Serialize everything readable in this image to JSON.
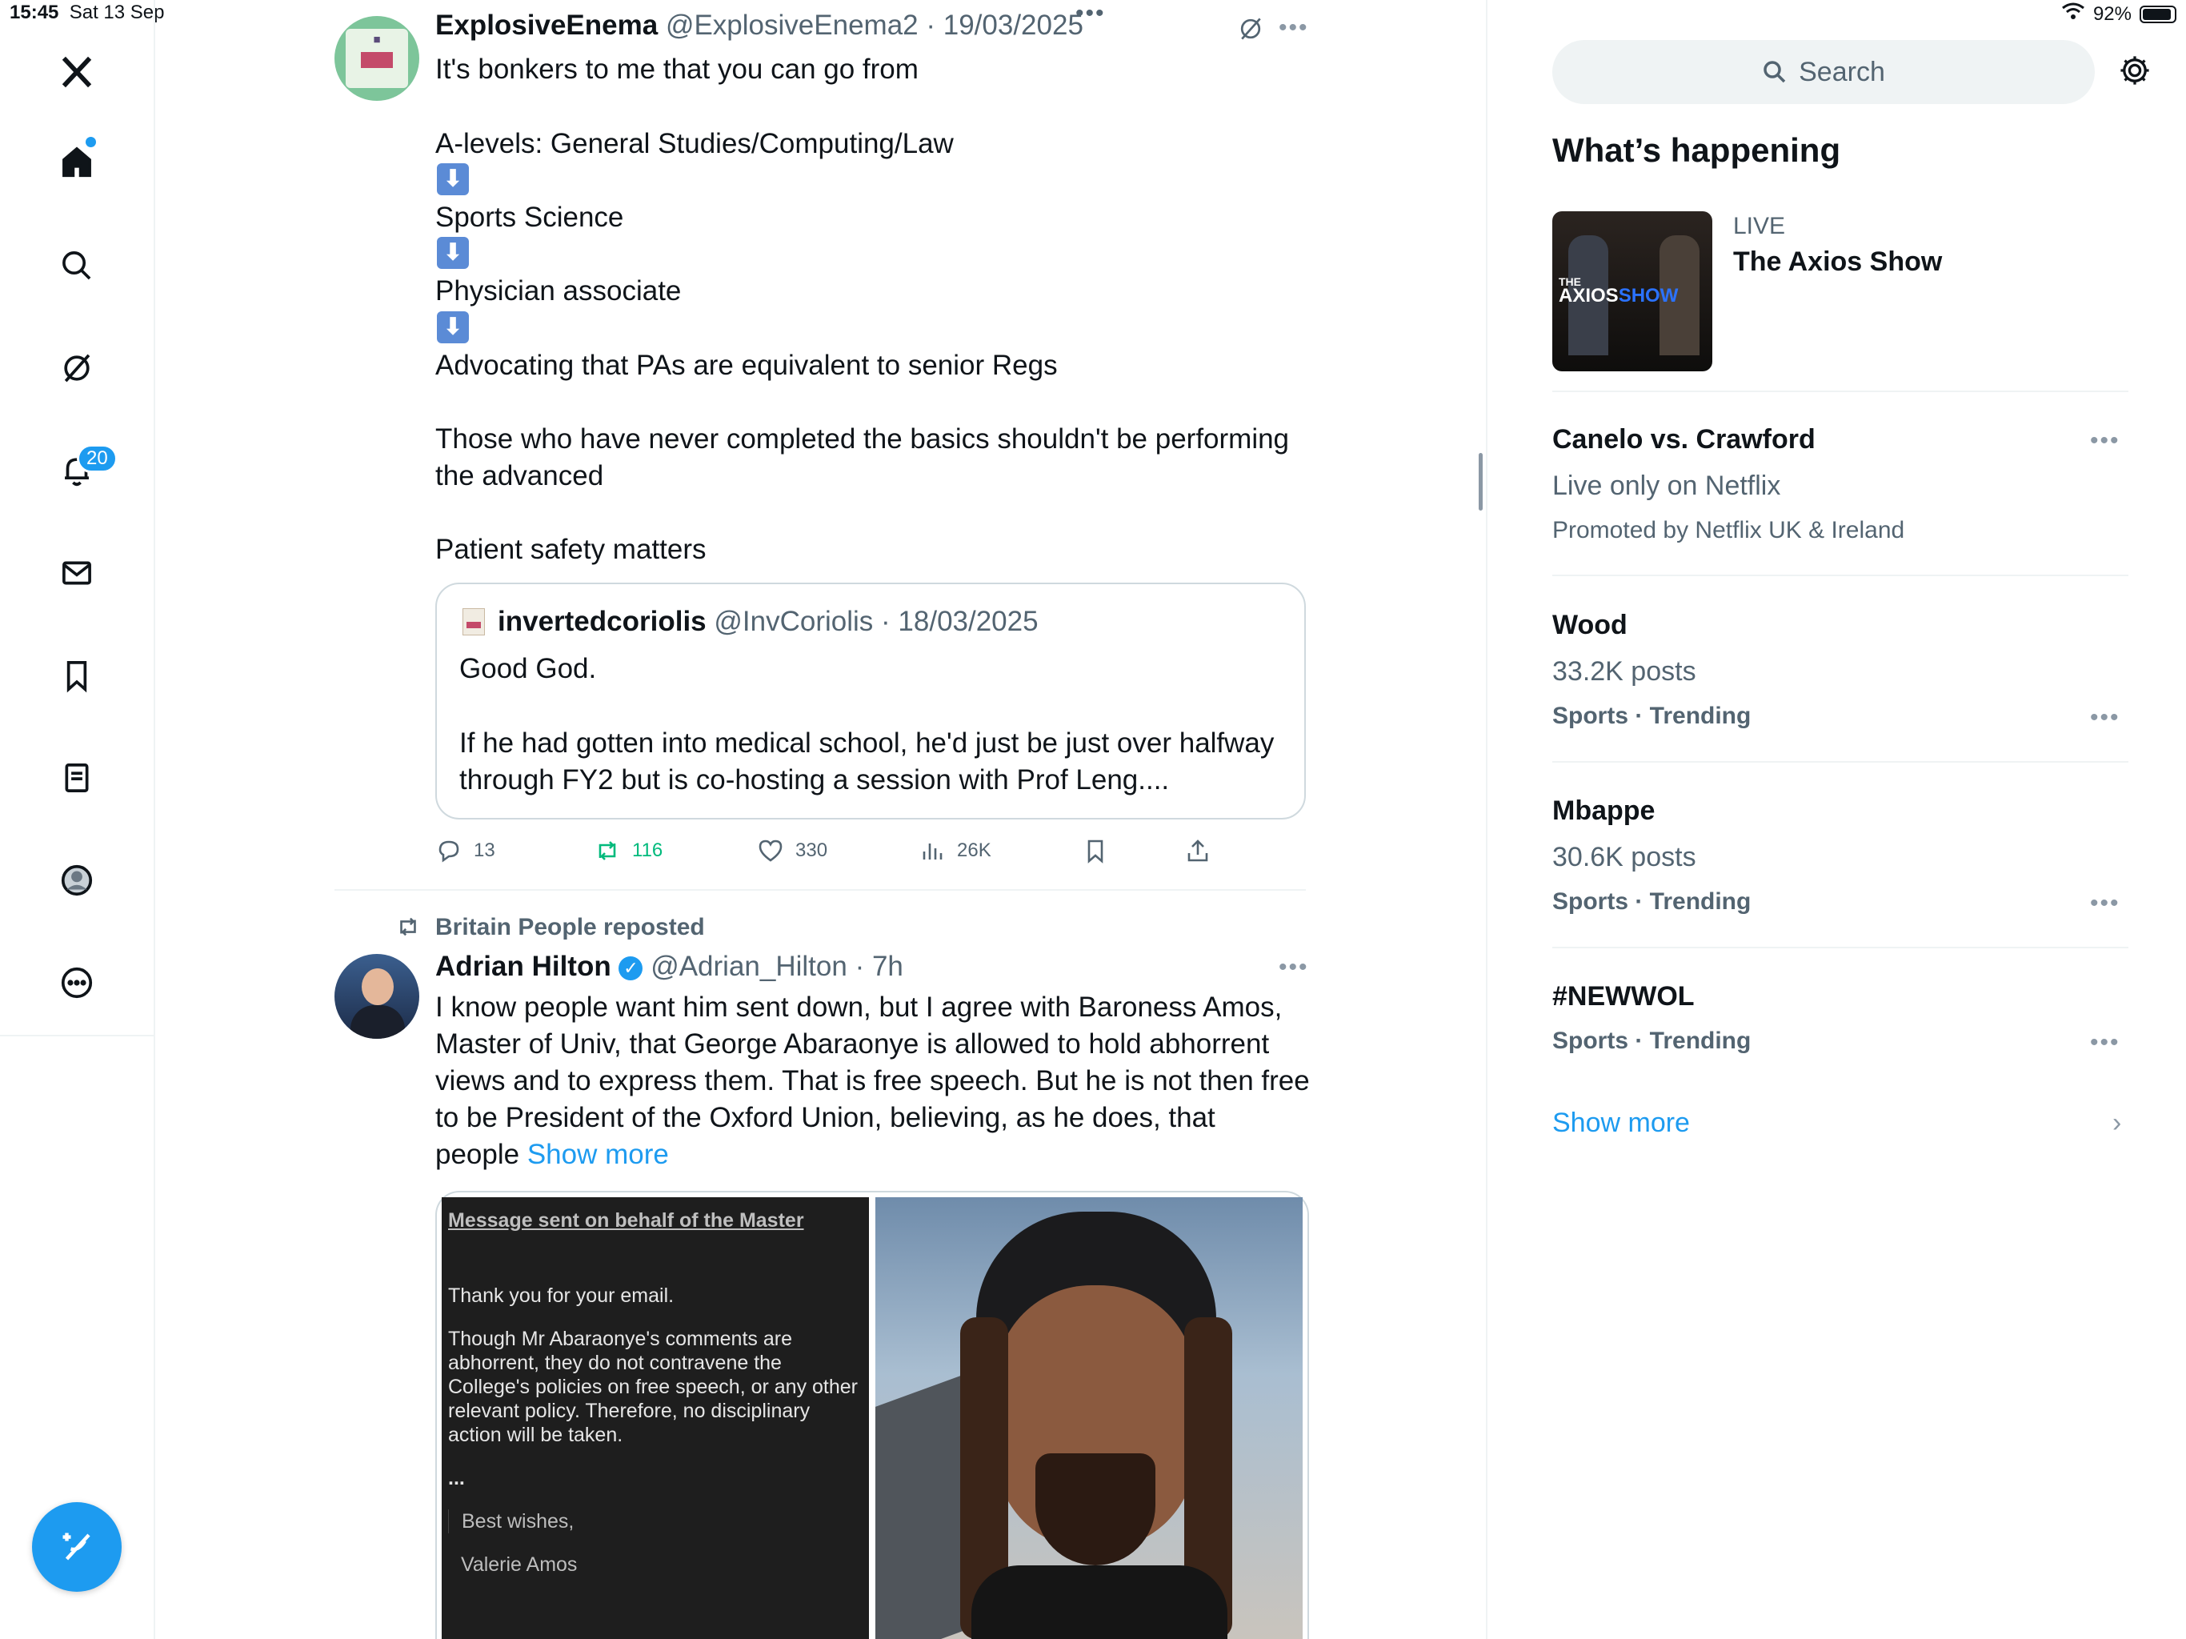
{
  "status_bar": {
    "time": "15:45",
    "date": "Sat 13 Sep",
    "battery": "92%",
    "battery_level": 0.92
  },
  "nav": {
    "items": [
      "home",
      "explore",
      "grok",
      "notifications",
      "messages",
      "bookmarks",
      "lists",
      "profile",
      "more"
    ],
    "notifications_badge": "20"
  },
  "tweet1": {
    "display_name": "ExplosiveEnema",
    "handle": "@ExplosiveEnema2",
    "date": "· 19/03/2025",
    "lines": {
      "l1": "It's bonkers to me that you can go from",
      "l2": "A-levels: General Studies/Computing/Law",
      "l3": "Sports Science",
      "l4": "Physician associate",
      "l5": "Advocating that PAs are equivalent to senior Regs",
      "l6": "Those who have never completed the basics shouldn't be performing\nthe advanced",
      "l7": "Patient safety matters"
    },
    "arrow_glyph": "⬇",
    "quote": {
      "display_name": "invertedcoriolis",
      "handle": "@InvCoriolis",
      "date": "· 18/03/2025",
      "l1": "Good God.",
      "l2": "If he had gotten into medical school, he'd just be just over halfway\nthrough FY2 but is co-hosting a session with Prof Leng...."
    },
    "stats": {
      "replies": "13",
      "reposts": "116",
      "likes": "330",
      "views": "26K"
    }
  },
  "tweet2": {
    "repost_label": "Britain People reposted",
    "display_name": "Adrian Hilton",
    "handle": "@Adrian_Hilton",
    "date": "· 7h",
    "text": "I know people want him sent down, but I agree with Baroness Amos,\nMaster of Univ, that George Abaraonye is allowed to hold abhorrent\nviews and to express them. That is free speech. But he is not then free\nto be President of the Oxford Union, believing, as he does, that\npeople ",
    "show_more": "Show more",
    "media_letter": {
      "heading": "Message sent on behalf of the Master",
      "p1": "Thank you for your email.",
      "p2": "Though Mr Abaraonye's comments are abhorrent, they do not contravene the College's policies on free speech, or any other relevant policy. Therefore, no disciplinary action will be taken.",
      "ellipsis": "...",
      "sign1": "Best wishes,",
      "sign2": "Valerie Amos"
    }
  },
  "sidebar": {
    "search_placeholder": "Search",
    "whats_happening": "What’s happening",
    "live": {
      "tag": "LIVE",
      "title": "The Axios Show",
      "thumb_the": "THE",
      "thumb_axios": "AXIOS",
      "thumb_show": "SHOW"
    },
    "promo": {
      "title": "Canelo vs. Crawford",
      "subtitle": "Live only on Netflix",
      "promoted": "Promoted by Netflix UK & Ireland"
    },
    "trends": [
      {
        "title": "Wood",
        "posts": "33.2K posts",
        "meta": "Sports · Trending"
      },
      {
        "title": "Mbappe",
        "posts": "30.6K posts",
        "meta": "Sports · Trending"
      },
      {
        "title": "#NEWWOL",
        "meta": "Sports · Trending"
      }
    ],
    "show_more": "Show more"
  }
}
